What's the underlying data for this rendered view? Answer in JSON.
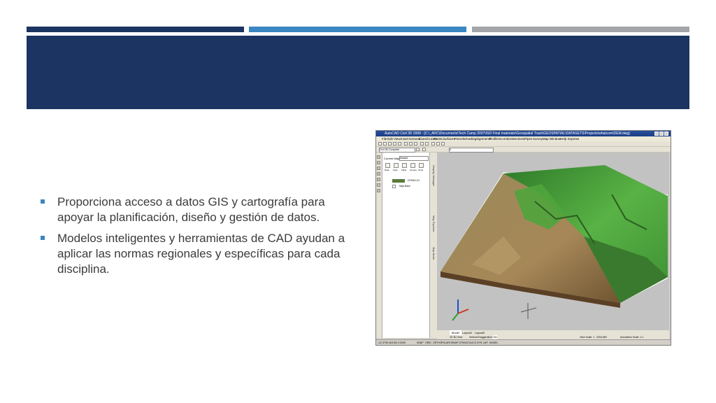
{
  "slide": {
    "bullets": [
      "Proporciona acceso a datos GIS y cartografía para apoyar la planificación, diseño y gestión de datos.",
      "Modelos inteligentes y herramientas de CAD ayudan a aplicar las normas regionales y específicas para cada disciplina."
    ]
  },
  "autocad": {
    "title": "AutoCAD Civil 3D 2008 - [C:\\_ARC\\Documents\\Tech Camp 2007\\ISD Final materials\\Geospatial Track\\GEOSPATIAL\\DATASETS\\Projects\\whatcom\\DEM.dwg]",
    "menus": [
      "File",
      "Edit",
      "View",
      "Insert",
      "General",
      "Lines/Curves",
      "Points",
      "Surfaces",
      "Parcels",
      "Grading",
      "Alignments",
      "Profiles",
      "Corridors",
      "Sections",
      "Pipes",
      "Survey",
      "Map",
      "Window",
      "Help",
      "Express"
    ],
    "help_placeholder": "Type a question for help",
    "workspace": "Civil 3D Complete",
    "layer": "0",
    "panel": {
      "current_map_label": "Current Map:",
      "current_map_value": "Default",
      "tools": [
        "Data",
        "Style",
        "Table",
        "Groups",
        "Tools"
      ],
      "layers": [
        "DTMD1-01",
        "Map Base"
      ],
      "side_tabs": [
        "Display Manager",
        "Map Explorer",
        "Map Book"
      ]
    },
    "layout_tabs": [
      "Model",
      "Layout1",
      "Layout2"
    ],
    "view_label": "2D 3D View",
    "vertical_exaggeration_label": "Vertical Exaggeration",
    "vertical_exaggeration_value": "10x",
    "view_scale": "View Scale: 1 : 3254.660",
    "annotation_scale": "Annotation Scale: 1:1",
    "coordinates": "-1/2 3735  40/1391 0.0000",
    "status_toggles": [
      "SNAP",
      "GRID",
      "ORTHO",
      "POLAR",
      "OSNAP",
      "OTRACK",
      "DUCS",
      "DYN",
      "LWT",
      "MODEL"
    ],
    "colors": {
      "title_bar": "#1a3d86",
      "terrain_green": "#4caa38",
      "terrain_brown": "#8a6b3d"
    }
  },
  "theme": {
    "navy": "#1b3461",
    "blue": "#3a87c2",
    "gray": "#a3a5a8"
  }
}
